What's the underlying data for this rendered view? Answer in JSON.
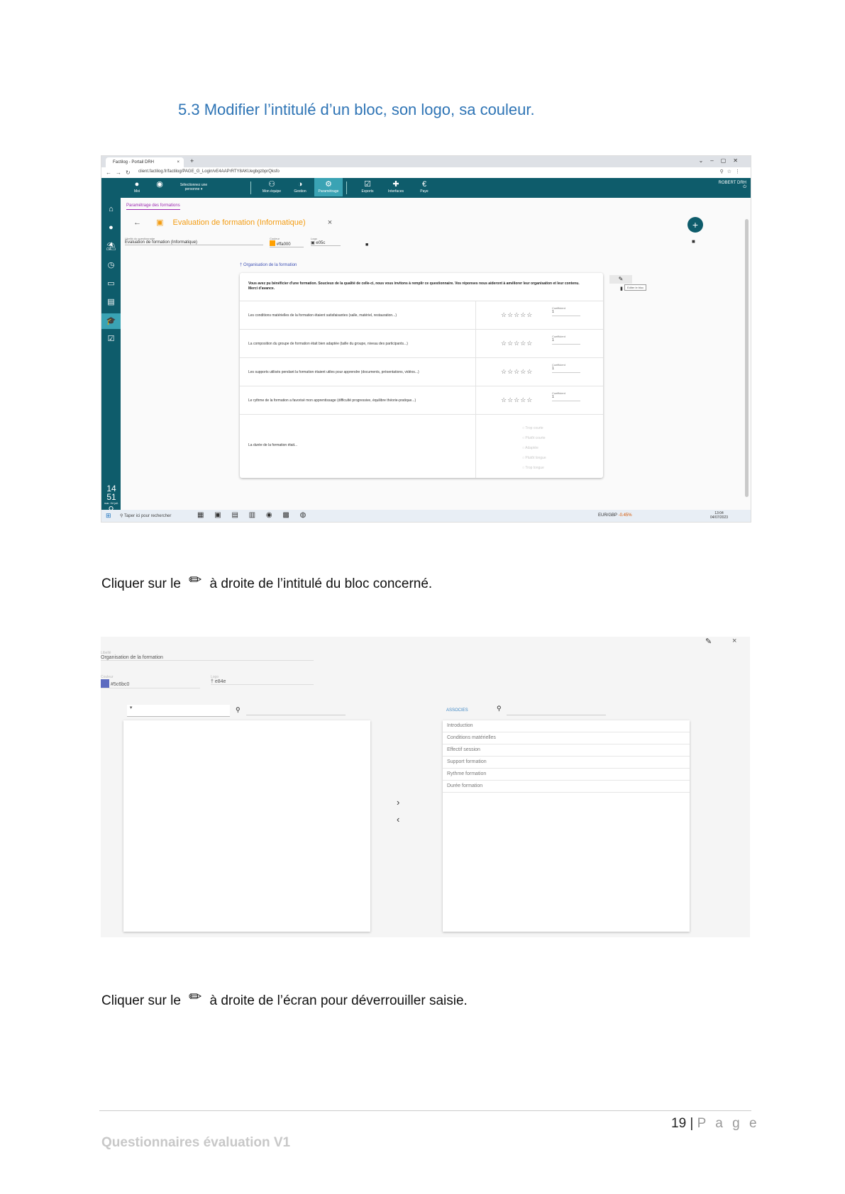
{
  "heading": "5.3 Modifier l’intitulé d’un bloc, son logo, sa couleur.",
  "browser": {
    "tab_title": "Factilog - Portail DRH",
    "url": "client.factilog.fr/factilog/PAGE_G_Login/vE4AAPrRTY8AKUegbgzbprQksfo"
  },
  "app": {
    "nav": [
      {
        "label": "Moi",
        "icon": "person-icon"
      },
      {
        "label": "Sélectionnez une personne",
        "icon": "account-circle-icon"
      },
      {
        "label": "Mon équipe",
        "icon": "group-icon"
      },
      {
        "label": "Gestion",
        "icon": "gestion-icon"
      },
      {
        "label": "Paramétrage",
        "icon": "gear-icon"
      },
      {
        "label": "Exports",
        "icon": "export-icon"
      },
      {
        "label": "Interfaces",
        "icon": "puzzle-icon"
      },
      {
        "label": "Paye",
        "icon": "euro-icon"
      }
    ],
    "user": "ROBERT DRH",
    "breadcrumb": "Paramétrage des formations",
    "form_title": "Evaluation de formation (Informatique)",
    "fields": {
      "libelle_label": "Libellé du questionnaire",
      "libelle_value": "Evaluation de formation (Informatique)",
      "couleur_label": "Couleur",
      "couleur_value": "#ffa000",
      "logo_label": "Logo",
      "logo_value": "e05c"
    },
    "block_title": "Organisation de la formation",
    "intro": "Vous avez pu bénéficier d'une formation. Soucieux de la qualité de celle-ci, nous vous invitons à remplir ce questionnaire. Vos réponses nous aideront à améliorer leur organisation et leur contenu. Merci d'avance.",
    "questions": [
      {
        "text": "Les conditions matérielles de la formation étaient satisfaisantes (salle, matériel, restauration...)",
        "stars": "☆☆☆☆☆",
        "coef_label": "Coefficient",
        "coef": "1"
      },
      {
        "text": "La composition du groupe de formation était bien adaptée (taille du groupe, niveau des participants...)",
        "stars": "☆☆☆☆☆",
        "coef_label": "Coefficient",
        "coef": "1"
      },
      {
        "text": "Les supports utilisés pendant la formation étaient utiles pour apprendre (documents, présentations, vidéos...)",
        "stars": "☆☆☆☆☆",
        "coef_label": "Coefficient",
        "coef": "1"
      },
      {
        "text": "Le rythme de la formation a favorisé mon apprentissage (difficulté progressive, équilibre théorie-pratique...)",
        "stars": "☆☆☆☆☆",
        "coef_label": "Coefficient",
        "coef": "1"
      }
    ],
    "last_question": "La durée de la formation était...",
    "radio_options": [
      "Trop courte",
      "Plutôt courte",
      "Adaptée",
      "Plutôt longue",
      "Trop longue"
    ],
    "edit_tooltip": "Editer le bloc",
    "clock": {
      "hour": "14",
      "minute": "51",
      "date": "mar. 04 juil."
    },
    "taskbar": {
      "search": "Taper ici pour rechercher",
      "ticker": "EUR/GBP",
      "ticker_change": "-0.45%",
      "time": "13:04",
      "date": "04/07/2023"
    }
  },
  "instruction1": {
    "before": "Cliquer sur le",
    "after": "à droite de l’intitulé du bloc concerné."
  },
  "editor": {
    "libelle_label": "Libellé",
    "libelle_value": "Organisation de la formation",
    "couleur_label": "Couleur",
    "couleur_value": "#5c6bc0",
    "logo_label": "Logo",
    "logo_value": "e84e",
    "associes_label": "ASSOCIES",
    "associated_items": [
      "Introduction",
      "Conditions matérielles",
      "Effectif session",
      "Support formation",
      "Rythme formation",
      "Durée formation"
    ]
  },
  "instruction2": {
    "before": "Cliquer sur le",
    "after": "à droite de l’écran pour déverrouiller saisie."
  },
  "footer": {
    "page_number": "19",
    "page_label": "P a g e",
    "document_title": "Questionnaires évaluation V1"
  },
  "colors": {
    "heading": "#2e74b5",
    "app_nav": "#0e5c6b",
    "accent_orange": "#f39c12",
    "block_color": "#5c6bc0"
  }
}
